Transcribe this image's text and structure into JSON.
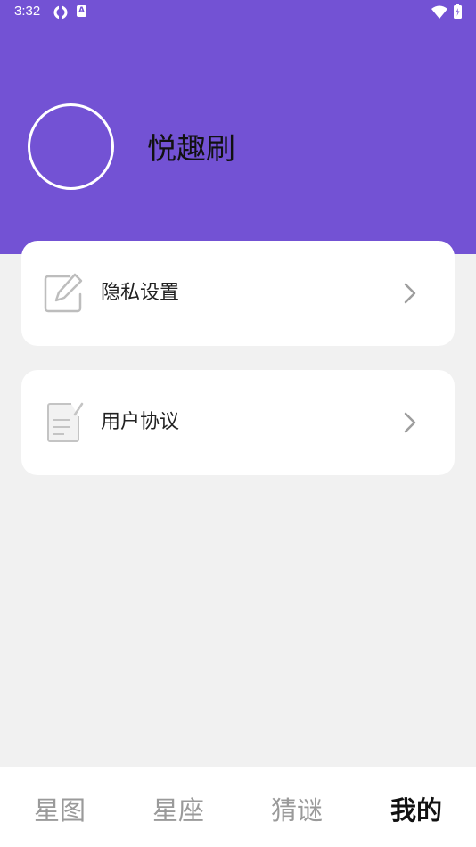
{
  "status_bar": {
    "time": "3:32",
    "small_icon_letter": "A"
  },
  "profile": {
    "app_name": "悦趣刷"
  },
  "menu": [
    {
      "label": "隐私设置",
      "icon": "edit-icon"
    },
    {
      "label": "用户协议",
      "icon": "document-icon"
    }
  ],
  "tabs": [
    {
      "label": "星图",
      "active": false
    },
    {
      "label": "星座",
      "active": false
    },
    {
      "label": "猜谜",
      "active": false
    },
    {
      "label": "我的",
      "active": true
    }
  ],
  "colors": {
    "header_bg": "#7352d4",
    "page_bg": "#f1f1f1",
    "card_bg": "#ffffff",
    "tab_inactive": "#9a9a9a",
    "tab_active": "#111111"
  }
}
